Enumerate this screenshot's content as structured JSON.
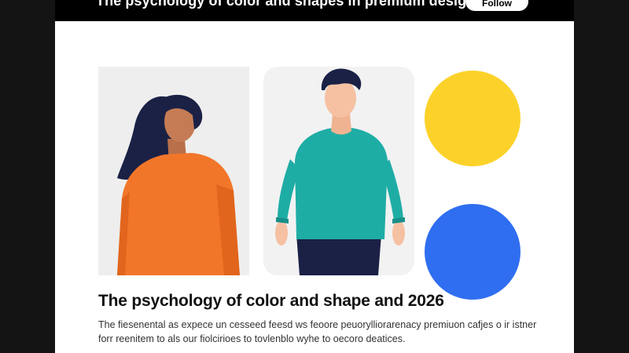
{
  "header": {
    "title": "The psychology of color and shapes in premium design",
    "follow_label": "Follow"
  },
  "article": {
    "title": "The psychology of color and shape and 2026",
    "body_line_1": "The fiesenental as expece un cesseed feesd ws feoore peuorylliorarenacy premiuon cafjes o ir istner",
    "body_line_2": "forr reenitem to als our fiolcirioes to tovlenblo wyhe to oecoro deatices."
  },
  "illustrations": {
    "left_figure": "woman-orange-sweater",
    "middle_figure": "man-teal-sweater",
    "shapes": [
      "yellow-circle",
      "blue-circle"
    ]
  },
  "colors": {
    "background": "#141414",
    "card": "#ffffff",
    "orange": "#f2762a",
    "teal": "#1eada5",
    "yellow": "#fcd22a",
    "blue": "#2f6ef0",
    "navy": "#1b2145"
  }
}
